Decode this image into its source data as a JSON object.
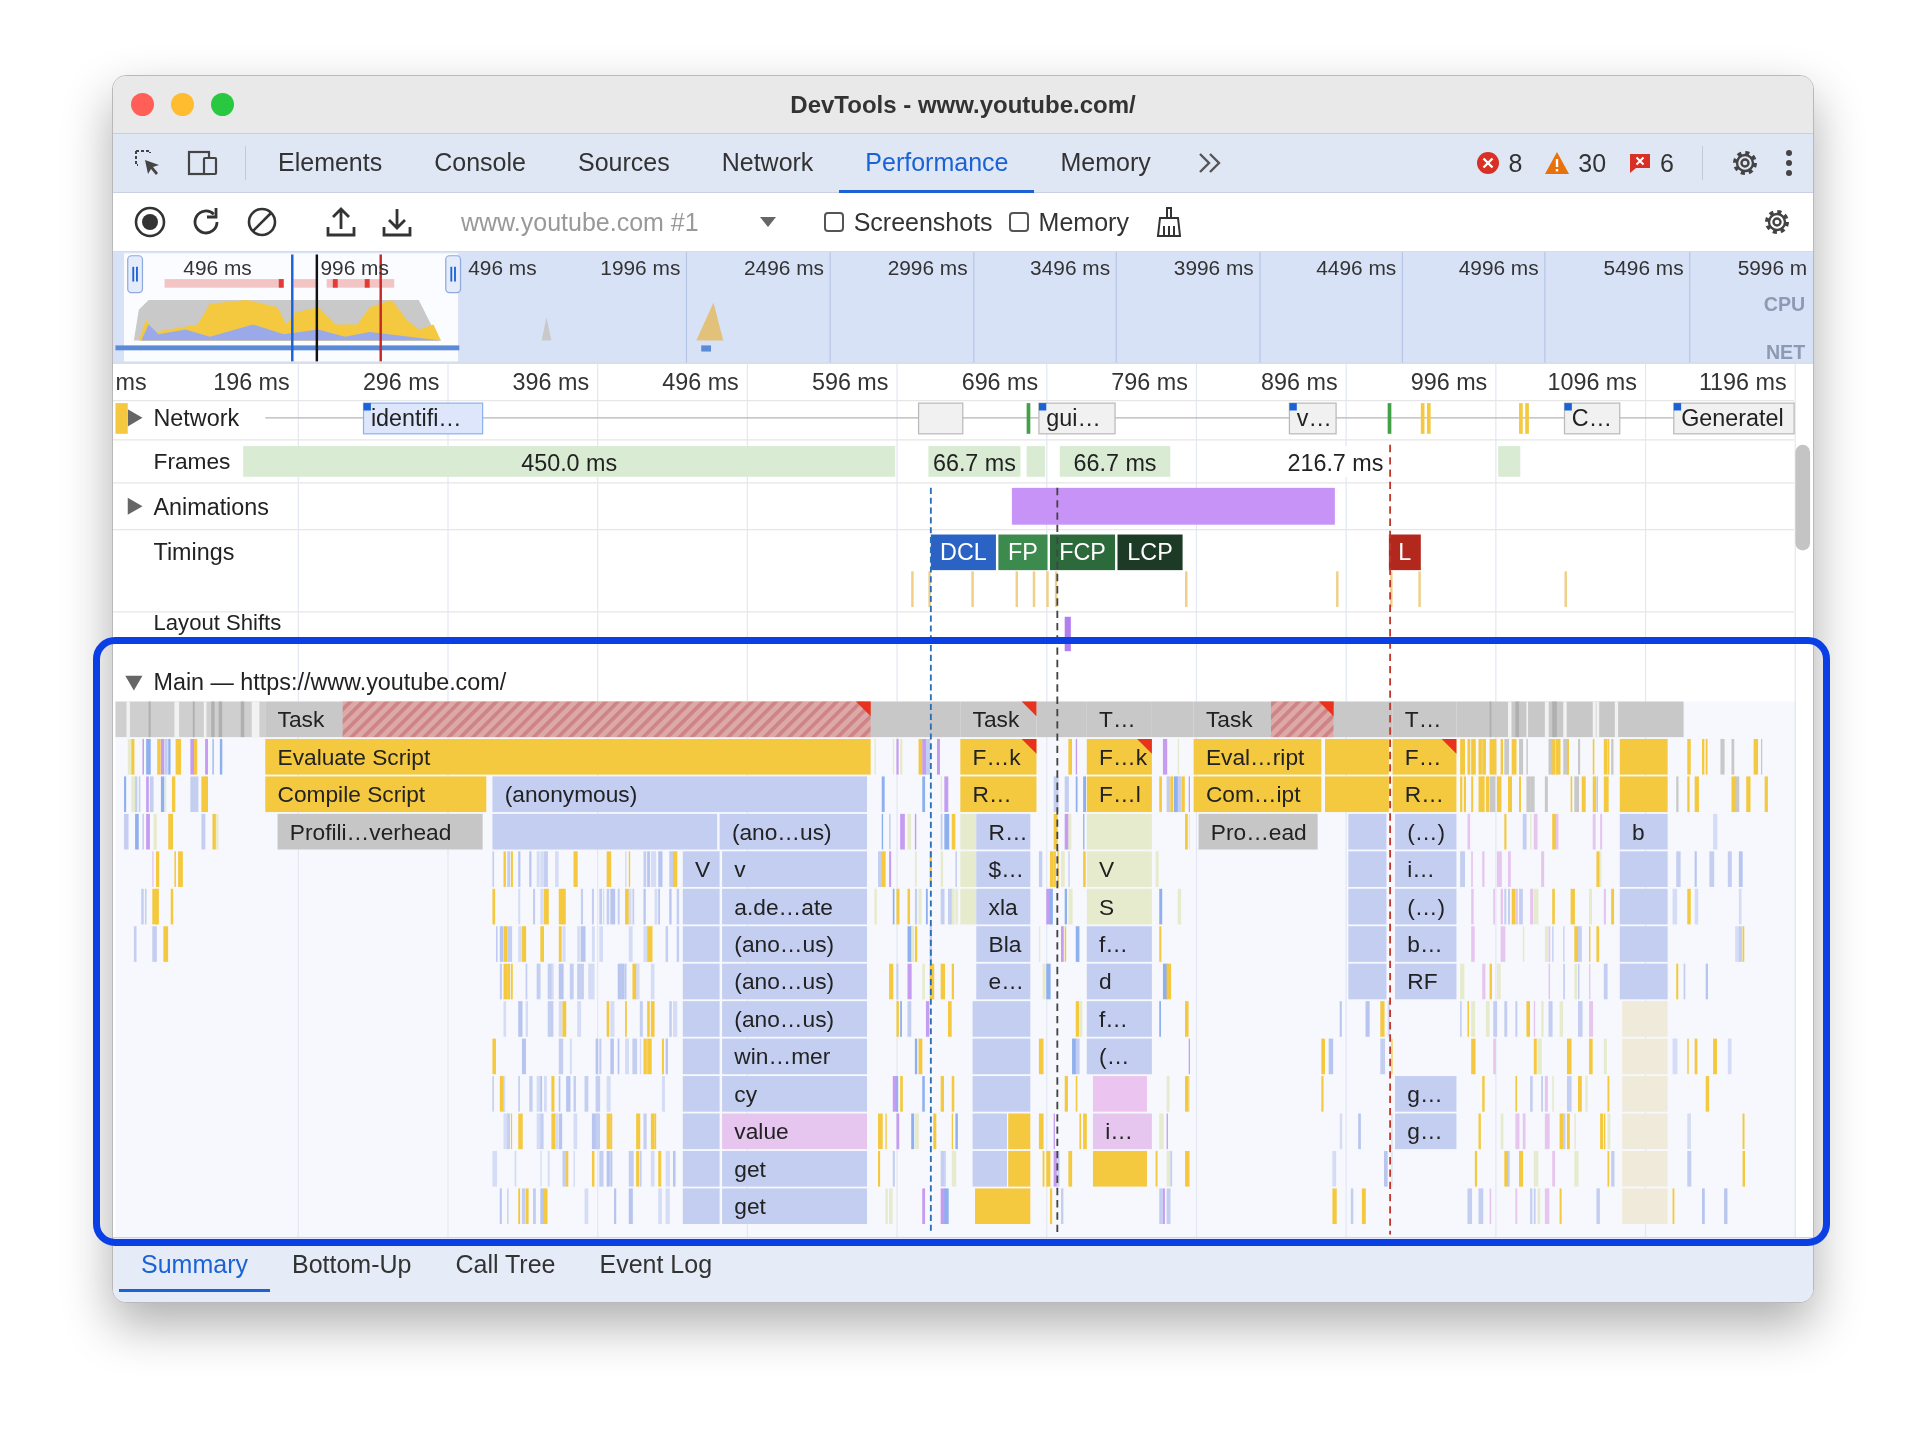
{
  "window": {
    "title": "DevTools - www.youtube.com/"
  },
  "tabs": [
    {
      "label": "Elements",
      "selected": false
    },
    {
      "label": "Console",
      "selected": false
    },
    {
      "label": "Sources",
      "selected": false
    },
    {
      "label": "Network",
      "selected": false
    },
    {
      "label": "Performance",
      "selected": true
    },
    {
      "label": "Memory",
      "selected": false
    }
  ],
  "issue_counts": {
    "errors": "8",
    "warnings": "30",
    "messages": "6"
  },
  "toolbar": {
    "recording": "www.youtube.com #1",
    "options": [
      {
        "label": "Screenshots",
        "checked": false
      },
      {
        "label": "Memory",
        "checked": false
      }
    ]
  },
  "overview": {
    "ticks": [
      "496 ms",
      "996 ms",
      "496 ms",
      "1996 ms",
      "2496 ms",
      "2996 ms",
      "3496 ms",
      "3996 ms",
      "4496 ms",
      "4996 ms",
      "5496 ms",
      "5996 m"
    ],
    "cpu_label": "CPU",
    "net_label": "NET"
  },
  "ruler": [
    "ms",
    "196 ms",
    "296 ms",
    "396 ms",
    "496 ms",
    "596 ms",
    "696 ms",
    "796 ms",
    "896 ms",
    "996 ms",
    "1096 ms",
    "1196 ms"
  ],
  "network": {
    "label": "Network",
    "expanded": false,
    "requests": [
      "identifi…",
      "gui…",
      "v…",
      "C…",
      "Generatel"
    ]
  },
  "frames": {
    "label": "Frames",
    "items": [
      {
        "duration": "450.0 ms",
        "kind": "filled"
      },
      {
        "duration": "66.7 ms",
        "kind": "filled"
      },
      {
        "duration": "66.7 ms",
        "kind": "filled"
      },
      {
        "duration": "216.7 ms",
        "kind": "plain"
      }
    ]
  },
  "animations": {
    "label": "Animations",
    "expanded": false
  },
  "timings": {
    "label": "Timings",
    "markers": [
      {
        "label": "DCL",
        "color": "#2a63c4"
      },
      {
        "label": "FP",
        "color": "#3d8a4e"
      },
      {
        "label": "FCP",
        "color": "#2c6a3c"
      },
      {
        "label": "LCP",
        "color": "#1d3a27"
      },
      {
        "label": "L",
        "color": "#b3281c"
      }
    ]
  },
  "layout_shifts": {
    "label": "Layout Shifts"
  },
  "main": {
    "title": "Main — https://www.youtube.com/",
    "expanded": true,
    "levels": [
      [
        {
          "label": "Task",
          "kind": "long_task",
          "warning": true
        },
        {
          "label": "Task",
          "kind": "long_task",
          "warning": true
        },
        {
          "label": "T…",
          "kind": "task",
          "warning": false
        },
        {
          "label": "Task",
          "kind": "long_task",
          "warning": true
        },
        {
          "label": "T…",
          "kind": "task",
          "warning": false
        }
      ],
      [
        {
          "label": "Evaluate Script",
          "kind": "script",
          "warning": false
        },
        {
          "label": "F…k",
          "kind": "script",
          "warning": true
        },
        {
          "label": "F…k",
          "kind": "script",
          "warning": true
        },
        {
          "label": "Eval…ript",
          "kind": "script",
          "warning": false
        },
        {
          "label": "F…",
          "kind": "script",
          "warning": true
        }
      ],
      [
        {
          "label": "Compile Script",
          "kind": "script",
          "warning": false
        },
        {
          "label": "(anonymous)",
          "kind": "function",
          "warning": false
        },
        {
          "label": "R…",
          "kind": "script",
          "warning": false
        },
        {
          "label": "F…l",
          "kind": "script",
          "warning": false
        },
        {
          "label": "Com…ipt",
          "kind": "script",
          "warning": false
        },
        {
          "label": "R…",
          "kind": "script",
          "warning": false
        }
      ],
      [
        {
          "label": "Profili…verhead",
          "kind": "overhead",
          "warning": false
        },
        {
          "label": "(ano…us)",
          "kind": "function",
          "warning": false
        },
        {
          "label": "R…",
          "kind": "function",
          "warning": false
        },
        {
          "label": "Pro…ead",
          "kind": "overhead",
          "warning": false
        },
        {
          "label": "(…)",
          "kind": "function",
          "warning": false
        },
        {
          "label": "b",
          "kind": "function",
          "warning": false
        }
      ],
      [
        {
          "label": "V",
          "kind": "function",
          "warning": false
        },
        {
          "label": "v",
          "kind": "function",
          "warning": false
        },
        {
          "label": "$…",
          "kind": "function",
          "warning": false
        },
        {
          "label": "V",
          "kind": "misc",
          "warning": false
        },
        {
          "label": "i…",
          "kind": "function",
          "warning": false
        }
      ],
      [
        {
          "label": "a.de…ate",
          "kind": "function",
          "warning": false
        },
        {
          "label": "xla",
          "kind": "function",
          "warning": false
        },
        {
          "label": "S",
          "kind": "misc",
          "warning": false
        },
        {
          "label": "(…)",
          "kind": "function",
          "warning": false
        }
      ],
      [
        {
          "label": "(ano…us)",
          "kind": "function",
          "warning": false
        },
        {
          "label": "Bla",
          "kind": "function",
          "warning": false
        },
        {
          "label": "f…",
          "kind": "function",
          "warning": false
        },
        {
          "label": "b…",
          "kind": "function",
          "warning": false
        }
      ],
      [
        {
          "label": "(ano…us)",
          "kind": "function",
          "warning": false
        },
        {
          "label": "e…",
          "kind": "function",
          "warning": false
        },
        {
          "label": "d",
          "kind": "function",
          "warning": false
        },
        {
          "label": "RF",
          "kind": "function",
          "warning": false
        }
      ],
      [
        {
          "label": "(ano…us)",
          "kind": "function",
          "warning": false
        },
        {
          "label": "f…",
          "kind": "function",
          "warning": false
        }
      ],
      [
        {
          "label": "win…mer",
          "kind": "function",
          "warning": false
        },
        {
          "label": "(…",
          "kind": "function",
          "warning": false
        }
      ],
      [
        {
          "label": "cy",
          "kind": "function",
          "warning": false
        },
        {
          "label": "g…",
          "kind": "function",
          "warning": false
        }
      ],
      [
        {
          "label": "value",
          "kind": "style",
          "warning": false
        },
        {
          "label": "i…",
          "kind": "style",
          "warning": false
        },
        {
          "label": "g…",
          "kind": "function",
          "warning": false
        }
      ],
      [
        {
          "label": "get",
          "kind": "function",
          "warning": false
        }
      ],
      [
        {
          "label": "get",
          "kind": "function",
          "warning": false
        }
      ]
    ]
  },
  "bottom_tabs": [
    {
      "label": "Summary",
      "selected": true
    },
    {
      "label": "Bottom-Up",
      "selected": false
    },
    {
      "label": "Call Tree",
      "selected": false
    },
    {
      "label": "Event Log",
      "selected": false
    }
  ]
}
